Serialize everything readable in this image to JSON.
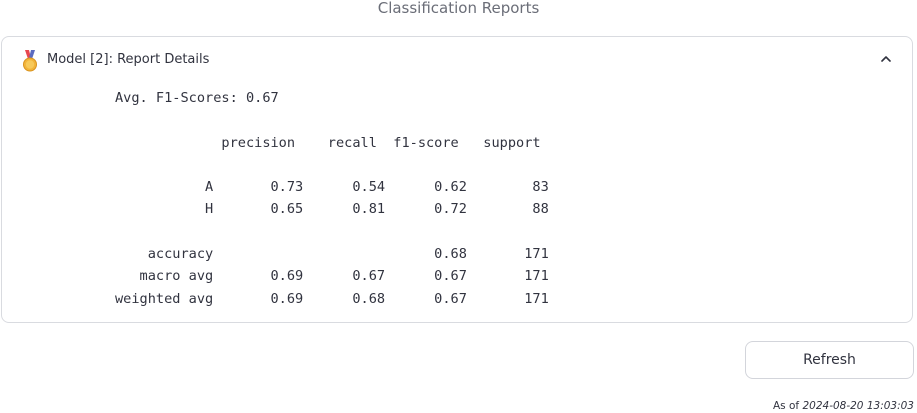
{
  "page": {
    "title": "Classification Reports"
  },
  "panel": {
    "icon": "medal-icon",
    "title": "Model [2]: Report Details",
    "expanded": true,
    "chevron_icon": "chevron-up-icon",
    "report_lines": [
      "Avg. F1-Scores: 0.67",
      "",
      "             precision    recall  f1-score   support",
      "",
      "           A       0.73      0.54      0.62        83",
      "           H       0.65      0.81      0.72        88",
      "",
      "    accuracy                           0.68       171",
      "   macro avg       0.69      0.67      0.67       171",
      "weighted avg       0.69      0.68      0.67       171"
    ]
  },
  "refresh": {
    "label": "Refresh"
  },
  "timestamp": {
    "prefix": "As of",
    "value": "2024-08-20 13:03:03"
  },
  "colors": {
    "text": "#31333f",
    "muted": "#6b6e78",
    "border": "#d9dbe0",
    "medal_gold": "#f2b43a",
    "medal_ribbon_left": "#e8474f",
    "medal_ribbon_right": "#5c6bc0"
  }
}
